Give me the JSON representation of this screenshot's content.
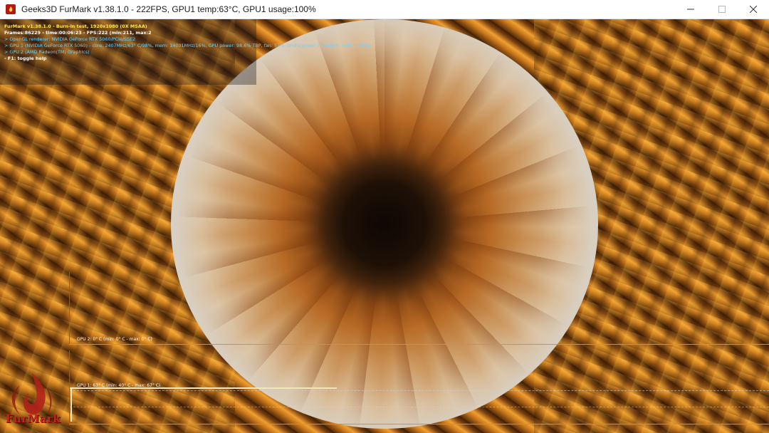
{
  "window": {
    "title": "Geeks3D FurMark v1.38.1.0 - 222FPS, GPU1 temp:63°C, GPU1 usage:100%",
    "icon": "furmark-icon",
    "controls": [
      "minimize-icon",
      "maximize-icon",
      "close-icon"
    ]
  },
  "osd": {
    "lines": [
      "FurMark v1.38.1.0 - Burn-in test, 1920x1080 (0X MSAA)",
      "Frames:86229 - time:00:06:23 - FPS:222 (min:211, max:2",
      "> OpenGL renderer: NVIDIA GeForce RTX 5060/PCIe/SSE2",
      "> GPU 1 (NVIDIA GeForce RTX 5060) - core: 2407MHz/63° C/98%, mem: 14001MHz/16%, GPU power: 98.6% TBP, fan: 57%, limits[power:1, temp:0, volt:0, OV:0]",
      "> GPU 2 (AMD Radeon(TM) Graphics)",
      "- F1: toggle help"
    ]
  },
  "graphs": {
    "gpu2_label": "GPU 2: 0° C (min: 0° C - max: 0° C)",
    "gpu1_label": "GPU 1: 63° C (min: 40° C - max: 67° C)"
  },
  "logo": {
    "text": "FurMark"
  },
  "colors": {
    "osd_title": "#ffe94a",
    "osd_info": "#6fd2ff",
    "graph_axis": "#ff2a1a",
    "graph_baseline": "#49b6e0",
    "logo": "#c0261a"
  }
}
